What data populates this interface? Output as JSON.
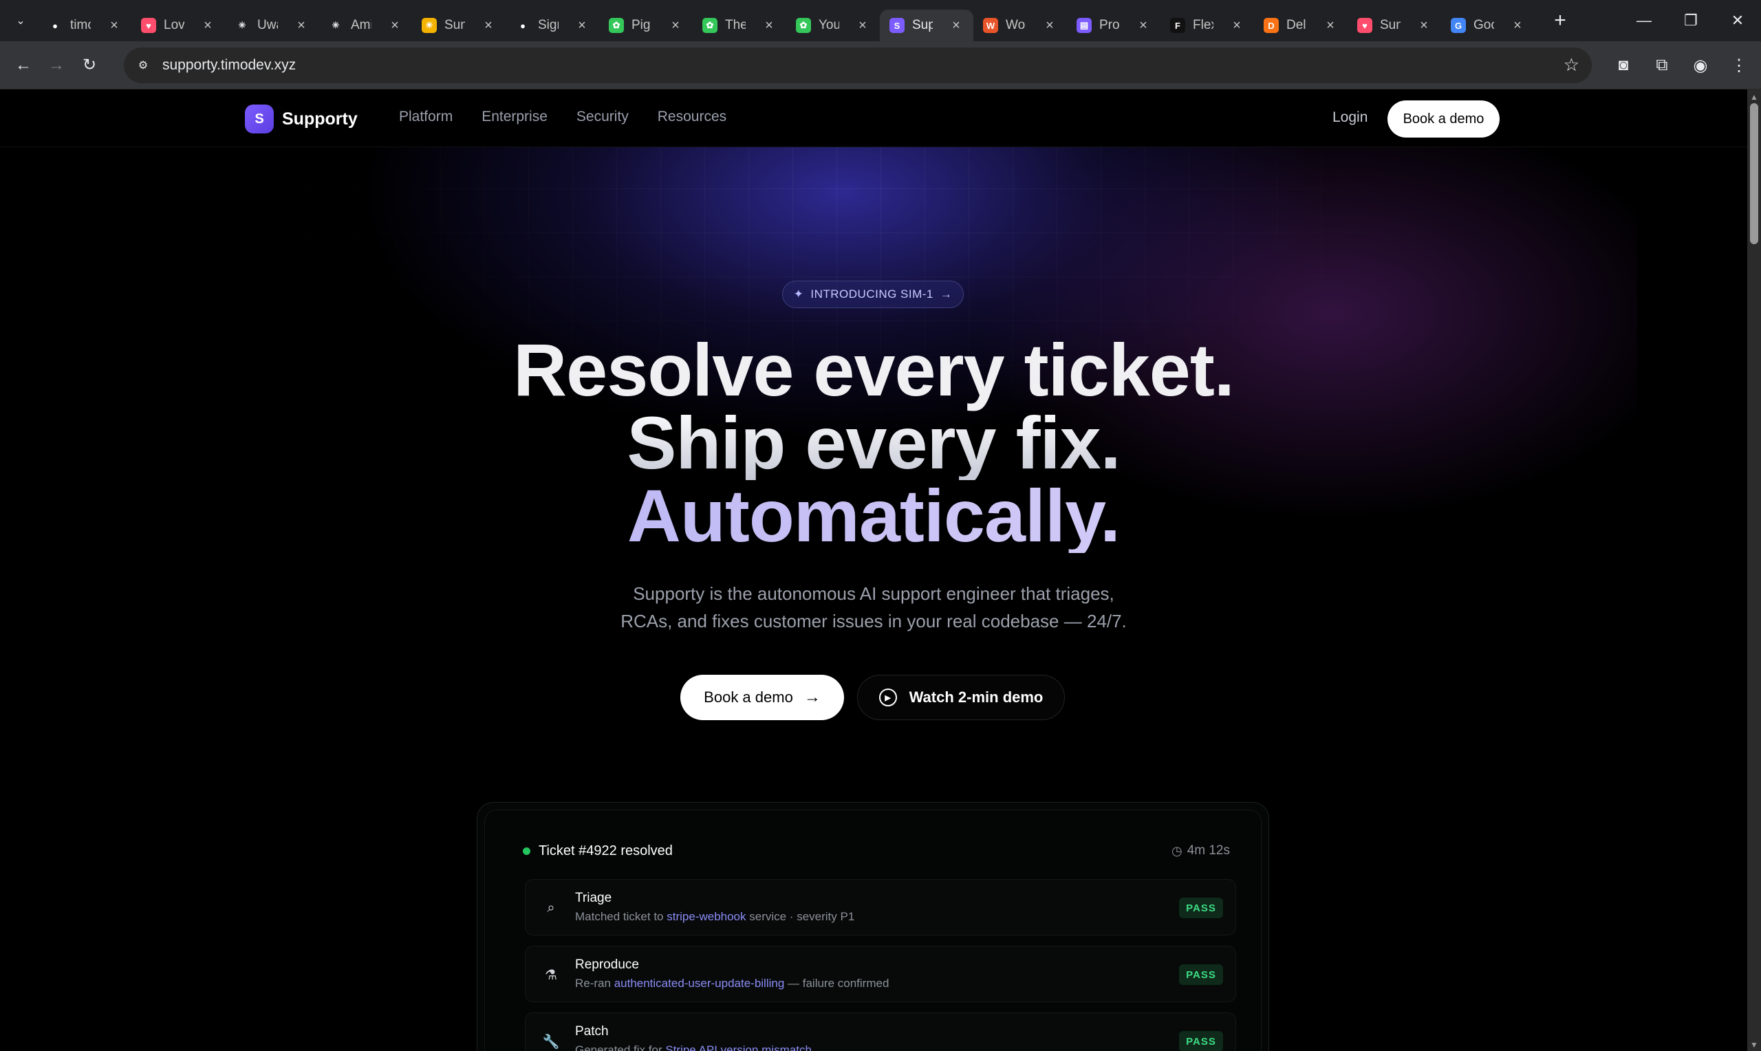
{
  "browser": {
    "tabs": [
      {
        "title": "timo",
        "favicon": "github-icon",
        "color": "#ffffff",
        "glyph": "●"
      },
      {
        "title": "Lov",
        "favicon": "heart-icon",
        "color": "#ff4d6d",
        "glyph": "♥"
      },
      {
        "title": "Uwa",
        "favicon": "asterisk-icon",
        "color": "#e8eaed",
        "glyph": "✳"
      },
      {
        "title": "Ami",
        "favicon": "asterisk-icon",
        "color": "#e8eaed",
        "glyph": "✳"
      },
      {
        "title": "Sun",
        "favicon": "sun-icon",
        "color": "#f5b301",
        "glyph": "☀"
      },
      {
        "title": "Sign",
        "favicon": "chat-icon",
        "color": "#ffffff",
        "glyph": "●"
      },
      {
        "title": "Pig",
        "favicon": "openai-icon",
        "color": "#34c759",
        "glyph": "✿"
      },
      {
        "title": "The",
        "favicon": "openai-icon",
        "color": "#34c759",
        "glyph": "✿"
      },
      {
        "title": "You",
        "favicon": "openai-icon",
        "color": "#34c759",
        "glyph": "✿"
      },
      {
        "title": "Sup",
        "favicon": "supporty-icon",
        "color": "#7c5cff",
        "glyph": "S",
        "active": true
      },
      {
        "title": "Wo",
        "favicon": "w-icon",
        "color": "#e8552a",
        "glyph": "W"
      },
      {
        "title": "Pro",
        "favicon": "doc-icon",
        "color": "#7c5cff",
        "glyph": "▤"
      },
      {
        "title": "Flex",
        "favicon": "flex-icon",
        "color": "#111111",
        "glyph": "F"
      },
      {
        "title": "Del",
        "favicon": "d-icon",
        "color": "#f97316",
        "glyph": "D"
      },
      {
        "title": "Sun",
        "favicon": "heart-icon",
        "color": "#ff4d6d",
        "glyph": "♥"
      },
      {
        "title": "Goo",
        "favicon": "google-icon",
        "color": "#4285f4",
        "glyph": "G"
      }
    ],
    "url": "supporty.timodev.xyz"
  },
  "nav": {
    "brand": "Supporty",
    "brand_mark": "S",
    "links": [
      "Platform",
      "Enterprise",
      "Security",
      "Resources"
    ],
    "login": "Login",
    "cta": "Book a demo"
  },
  "hero": {
    "pill": "INTRODUCING SIM-1",
    "line1": "Resolve every ticket.",
    "line2": "Ship every fix.",
    "line3": "Automatically.",
    "sub1": "Supporty is the autonomous AI support engineer that triages,",
    "sub2": "RCAs, and fixes customer issues in your real codebase — 24/7.",
    "primary_cta": "Book a demo",
    "secondary_cta": "Watch 2-min demo"
  },
  "card": {
    "ticket": "Ticket #4922 resolved",
    "elapsed": "4m 12s",
    "steps": [
      {
        "title": "Triage",
        "pre": "Matched ticket to ",
        "hl": "stripe-webhook",
        "post": " service · severity P1",
        "status": "PASS",
        "icon": "search-icon"
      },
      {
        "title": "Reproduce",
        "pre": "Re-ran ",
        "hl": "authenticated-user-update-billing",
        "post": " — failure confirmed",
        "status": "PASS",
        "icon": "flask-icon"
      },
      {
        "title": "Patch",
        "pre": "Generated fix for ",
        "hl": "Stripe API version mismatch",
        "post": "",
        "status": "PASS",
        "icon": "wrench-icon"
      }
    ]
  },
  "colors": {
    "accent": "#7c5cff",
    "pass": "#3ddc84",
    "link": "#8b8cf5"
  }
}
